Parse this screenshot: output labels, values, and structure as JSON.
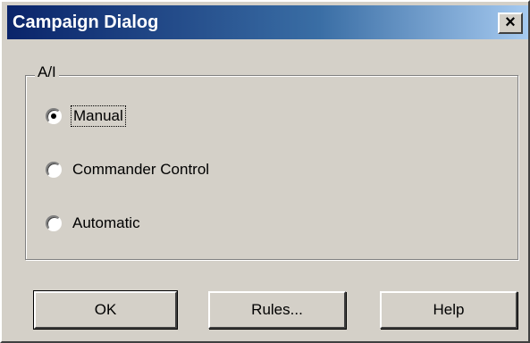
{
  "window": {
    "title": "Campaign Dialog",
    "close_label": "×"
  },
  "ai_group": {
    "legend": "A/I",
    "options": [
      {
        "label": "Manual",
        "selected": true
      },
      {
        "label": "Commander Control",
        "selected": false
      },
      {
        "label": "Automatic",
        "selected": false
      }
    ]
  },
  "buttons": {
    "ok": "OK",
    "rules": "Rules...",
    "help": "Help"
  }
}
